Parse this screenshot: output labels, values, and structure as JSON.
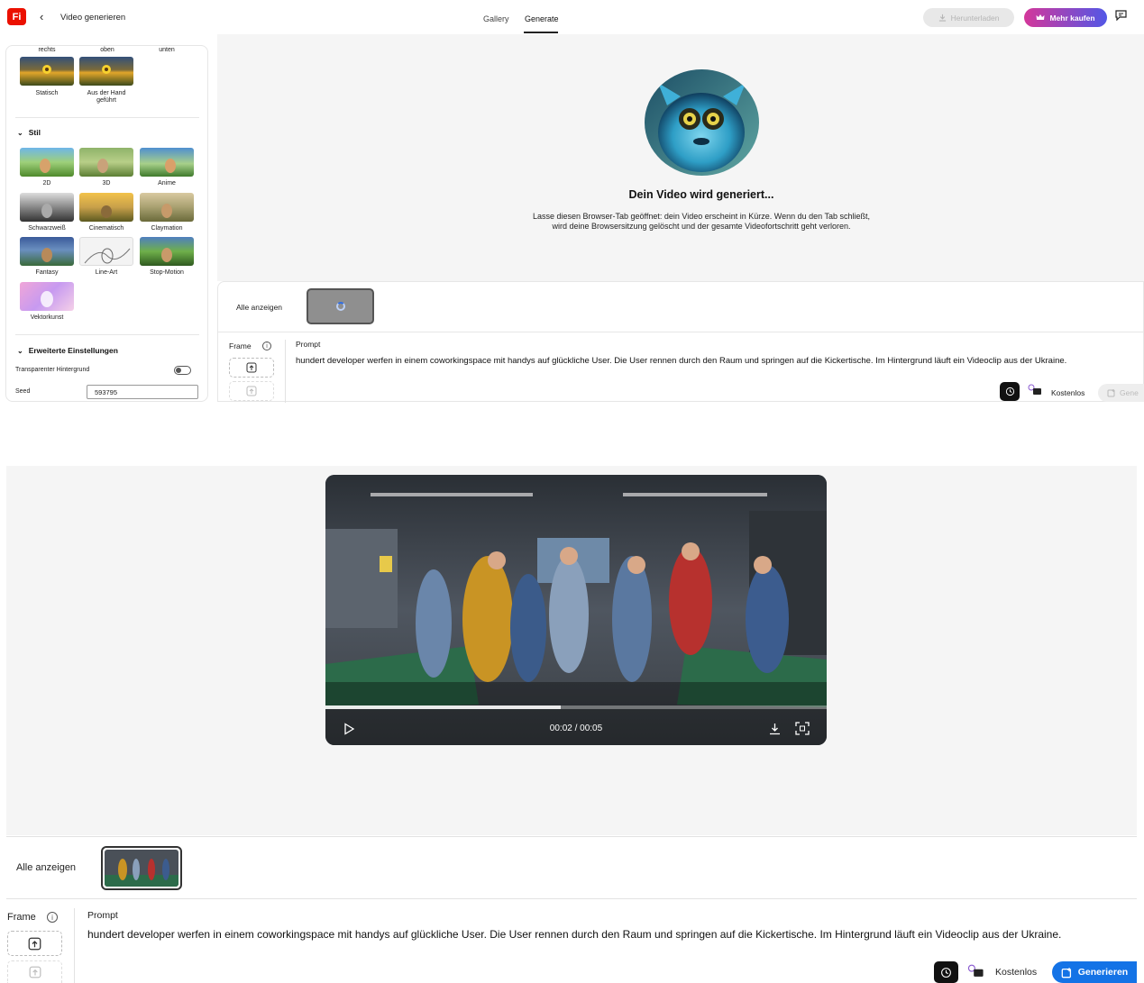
{
  "header": {
    "logo": "Fi",
    "title": "Video generieren",
    "tabs": [
      {
        "label": "Gallery"
      },
      {
        "label": "Generate"
      }
    ],
    "download_label": "Herunterladen",
    "buy_label": "Mehr kaufen"
  },
  "sidebar": {
    "camera_labels": [
      "rechts",
      "oben",
      "unten"
    ],
    "motion_items": [
      {
        "label": "Statisch"
      },
      {
        "label": "Aus der Hand geführt"
      }
    ],
    "style_section": "Stil",
    "style_items": [
      {
        "label": "2D"
      },
      {
        "label": "3D"
      },
      {
        "label": "Anime"
      },
      {
        "label": "Schwarzweiß"
      },
      {
        "label": "Cinematisch"
      },
      {
        "label": "Claymation"
      },
      {
        "label": "Fantasy"
      },
      {
        "label": "Line-Art"
      },
      {
        "label": "Stop-Motion"
      },
      {
        "label": "Vektorkunst"
      }
    ],
    "advanced_section": "Erweiterte Einstellungen",
    "transparent_label": "Transparenter Hintergrund",
    "seed_label": "Seed",
    "seed_value": "593795"
  },
  "generation": {
    "title": "Dein Video wird generiert...",
    "description": "Lasse diesen Browser-Tab geöffnet: dein Video erscheint in Kürze. Wenn du den Tab schließt, wird deine Browsersitzung gelöscht und der gesamte Videofortschritt geht verloren."
  },
  "panel": {
    "show_all": "Alle anzeigen",
    "frame_label": "Frame",
    "prompt_label": "Prompt",
    "prompt_text": "hundert developer werfen in einem coworkingspace mit handys auf glückliche User. Die User rennen durch den Raum und springen auf die Kickertische. Im Hintergrund läuft ein Videoclip aus der Ukraine.",
    "free_label": "Kostenlos",
    "generate_label": "Generieren",
    "generate_label_truncated": "Gene"
  },
  "video": {
    "time": "00:02 / 00:05",
    "progress": 0.47
  },
  "colors": {
    "brand": "#eb1000",
    "primary_button": "#1473e6",
    "buy_gradient_start": "#d4379a",
    "buy_gradient_end": "#5257e6"
  }
}
